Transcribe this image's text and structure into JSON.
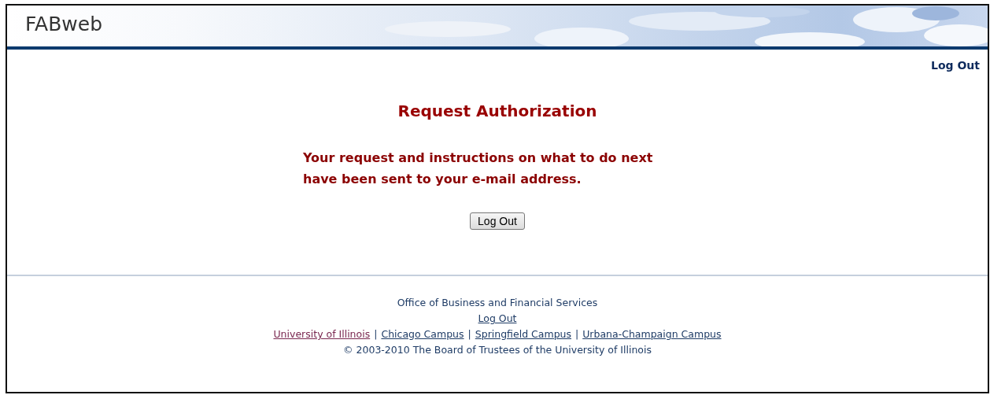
{
  "header": {
    "title": "FABweb"
  },
  "top_link": "Log Out",
  "main": {
    "heading": "Request Authorization",
    "message_lines": [
      "Your request and instructions on what to do next",
      "have been sent to your e-mail address."
    ],
    "button": "Log Out"
  },
  "footer": {
    "office": "Office of Business and Financial Services",
    "logout_link": "Log Out",
    "campus_links": [
      {
        "label": "University of Illinois",
        "visited": true
      },
      {
        "label": "Chicago Campus",
        "visited": false
      },
      {
        "label": "Springfield Campus",
        "visited": false
      },
      {
        "label": "Urbana-Champaign Campus",
        "visited": false
      }
    ],
    "separator": "|",
    "copyright": "© 2003-2010 The Board of Trustees of the University of Illinois"
  }
}
